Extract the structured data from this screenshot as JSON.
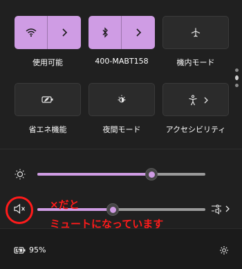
{
  "tiles": [
    {
      "label": "使用可能",
      "icon": "wifi-icon",
      "active": true
    },
    {
      "label": "400-MABT158",
      "icon": "bluetooth-icon",
      "active": true
    },
    {
      "label": "機内モード",
      "icon": "airplane-icon",
      "active": false
    },
    {
      "label": "省エネ機能",
      "icon": "battery-saver-icon",
      "active": false
    },
    {
      "label": "夜間モード",
      "icon": "night-light-icon",
      "active": false
    },
    {
      "label": "アクセシビリティ",
      "icon": "accessibility-icon",
      "active": false
    }
  ],
  "brightness": {
    "icon": "sun-icon",
    "level": 0.68
  },
  "volume": {
    "icon": "speaker-muted-icon",
    "level": 0.45,
    "muted": true
  },
  "annotation": {
    "line1": "×だと",
    "line2": "ミュートになっています"
  },
  "battery": {
    "percent": "95%",
    "icon": "battery-charging-icon"
  },
  "colors": {
    "accent": "#cf9ce4",
    "background": "#202020",
    "annotation": "#ff1b1b"
  },
  "settings_icon": "gear-icon"
}
